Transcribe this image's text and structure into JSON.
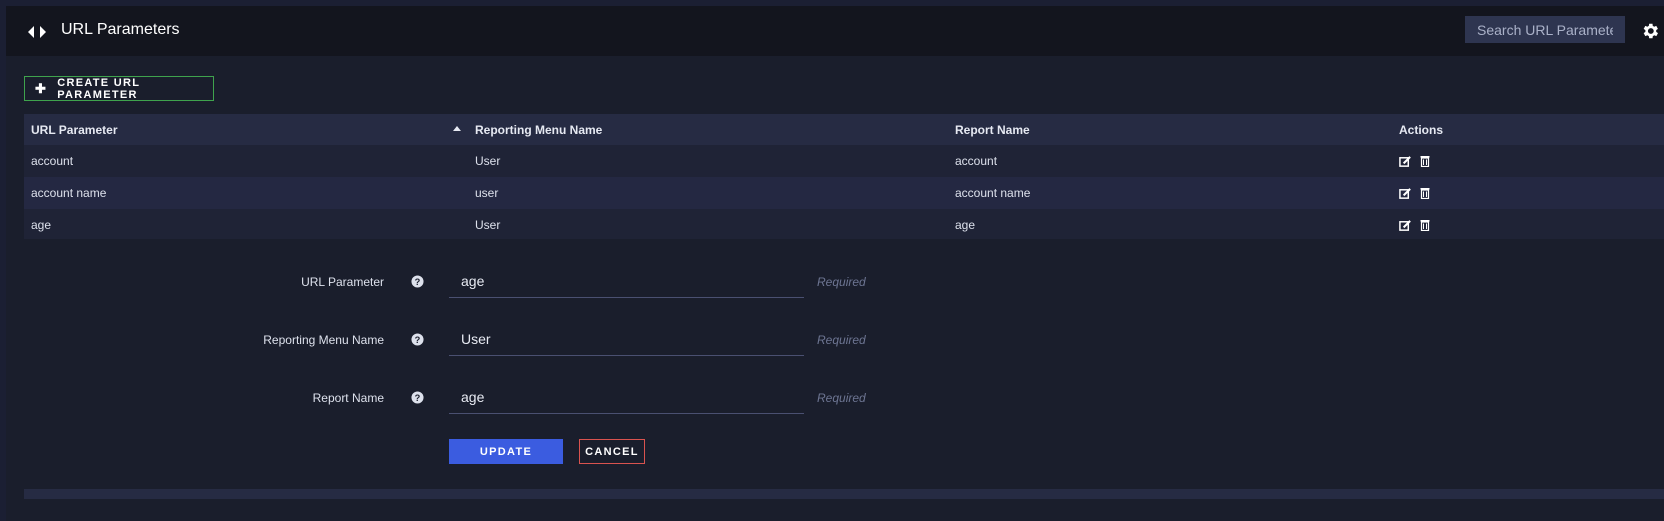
{
  "header": {
    "title": "URL Parameters",
    "search_placeholder": "Search URL Parameter"
  },
  "toolbar": {
    "create_label": "CREATE URL PARAMETER"
  },
  "table": {
    "columns": [
      "URL Parameter",
      "Reporting Menu Name",
      "Report Name",
      "Actions"
    ],
    "rows": [
      {
        "url_parameter": "account",
        "reporting_menu_name": "User",
        "report_name": "account"
      },
      {
        "url_parameter": "account name",
        "reporting_menu_name": "user",
        "report_name": "account name"
      },
      {
        "url_parameter": "age",
        "reporting_menu_name": "User",
        "report_name": "age"
      }
    ]
  },
  "form": {
    "fields": [
      {
        "label": "URL Parameter",
        "value": "age",
        "hint": "Required"
      },
      {
        "label": "Reporting Menu Name",
        "value": "User",
        "hint": "Required"
      },
      {
        "label": "Report Name",
        "value": "age",
        "hint": "Required"
      }
    ],
    "update_label": "UPDATE",
    "cancel_label": "CANCEL"
  },
  "icons": {
    "brand": "code-arrows-icon",
    "settings": "gear-icon",
    "create": "plus-icon",
    "sort": "sort-ascending-icon",
    "edit": "edit-icon",
    "delete": "trash-icon",
    "help": "question-circle-icon"
  },
  "colors": {
    "primary_button": "#3b5ce0",
    "create_border": "#3fa34d",
    "cancel_border": "#d9534f"
  }
}
